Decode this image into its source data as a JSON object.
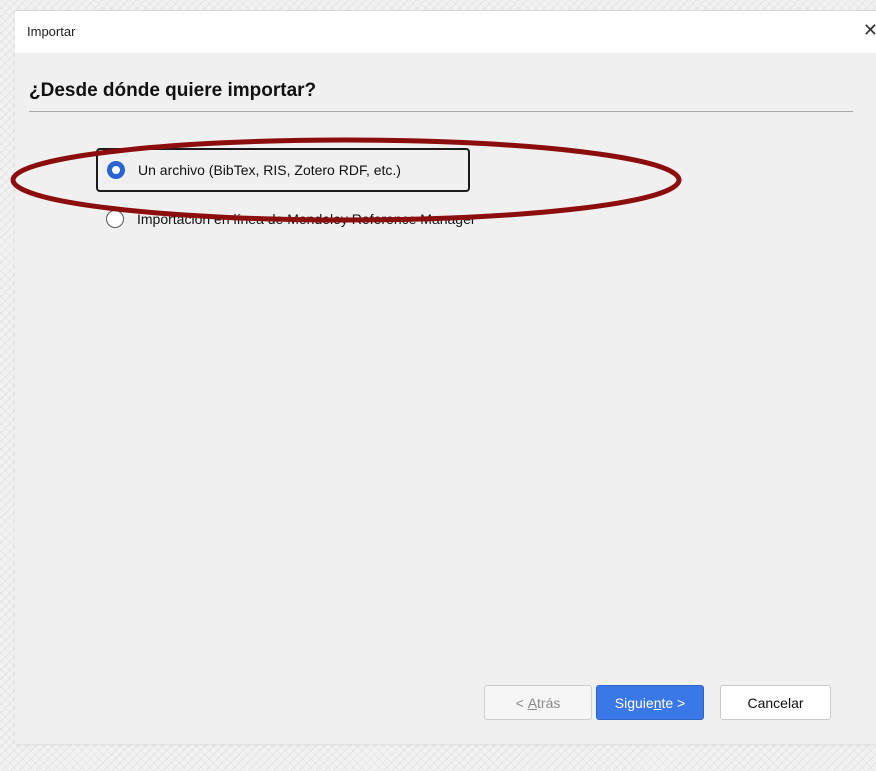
{
  "window": {
    "title": "Importar",
    "close_glyph": "✕"
  },
  "heading": "¿Desde dónde quiere importar?",
  "options": [
    {
      "label": "Un archivo (BibTex, RIS, Zotero RDF, etc.)",
      "selected": true
    },
    {
      "label": "Importación en línea de Mendeley Reference Manager",
      "selected": false
    }
  ],
  "buttons": {
    "back": {
      "prefix": "< ",
      "mnemonic": "A",
      "rest": "trás",
      "enabled": false
    },
    "next": {
      "prefix": "Siguie",
      "mnemonic": "n",
      "rest": "te >",
      "enabled": true
    },
    "cancel": {
      "label": "Cancelar",
      "enabled": true
    }
  },
  "colors": {
    "accent": "#3b78e7",
    "highlight_ellipse": "#8b0d0d"
  },
  "icons": {
    "close": "close-icon",
    "radio_checked": "radio-checked-icon",
    "radio_unchecked": "radio-unchecked-icon"
  }
}
